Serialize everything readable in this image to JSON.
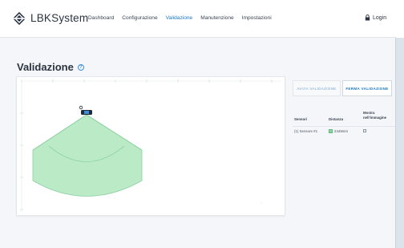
{
  "brand": {
    "name": "LBKSystem"
  },
  "nav": {
    "items": [
      {
        "label": "Dashboard",
        "active": false
      },
      {
        "label": "Configurazione",
        "active": false
      },
      {
        "label": "Validazione",
        "active": true
      },
      {
        "label": "Manutenzione",
        "active": false
      },
      {
        "label": "Impostazioni",
        "active": false
      }
    ],
    "login": "Login",
    "login_icon": "lock-icon"
  },
  "page": {
    "title": "Validazione",
    "help_icon": "help-icon"
  },
  "colors": {
    "accent": "#1a78c2",
    "field": "#b4e8c1",
    "field_stroke": "#7fcc97",
    "sensor": "#1f2a3a"
  },
  "actions": {
    "start": "AVVIA VALIDAZIONE",
    "stop": "FERMA VALIDAZIONE"
  },
  "table": {
    "headers": {
      "sensor": "Sensori",
      "distance": "Distanza",
      "show": "Mostra nell'immagine"
    },
    "rows": [
      {
        "sensor": "(1) Sensore #1",
        "distance": "2449mm",
        "checked": false
      }
    ]
  }
}
